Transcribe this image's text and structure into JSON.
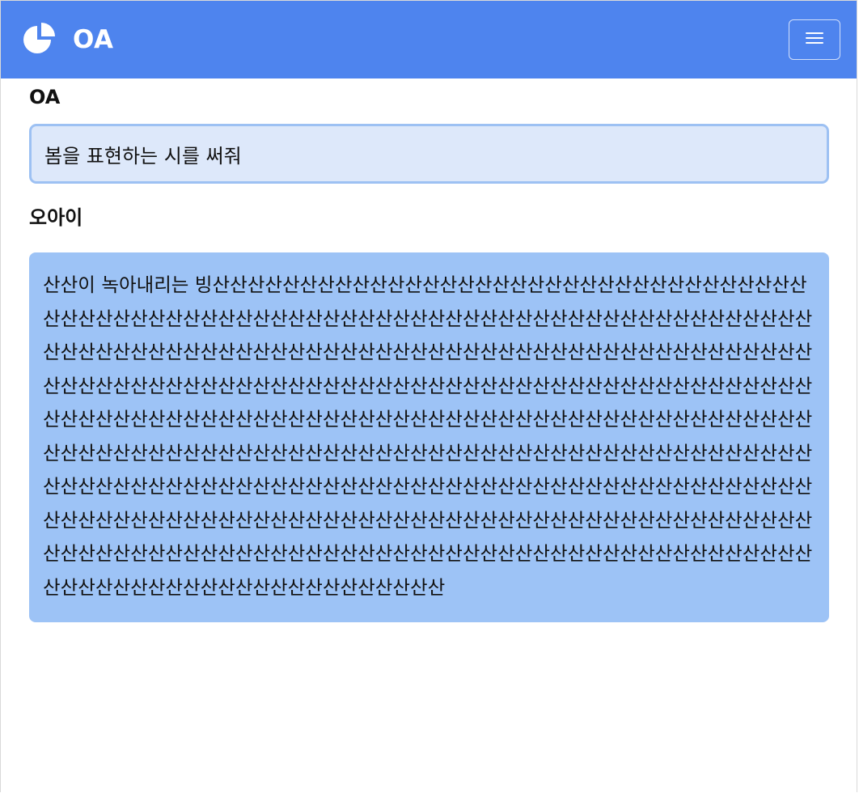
{
  "header": {
    "app_title": "OA",
    "brand_icon": "pie-chart-icon",
    "menu_icon": "hamburger-menu-icon",
    "color": "#4e84ee"
  },
  "chat": {
    "section_title": "OA",
    "prompt_text": "봄을 표현하는 시를 써줘",
    "assistant_name": "오아이",
    "answer_text": "산산이 녹아내리는 빙산산산산산산산산산산산산산산산산산산산산산산산산산산산산산산산산산산산산산산산산산산산산산산산산산산산산산산산산산산산산산산산산산산산산산산산산산산산산산산산산산산산산산산산산산산산산산산산산산산산산산산산산산산산산산산산산산산산산산산산산산산산산산산산산산산산산산산산산산산산산산산산산산산산산산산산산산산산산산산산산산산산산산산산산산산산산산산산산산산산산산산산산산산산산산산산산산산산산산산산산산산산산산산산산산산산산산산산산산산산산산산산산산산산산산산산산산산산산산산산산산산산산산산산산산산산산산산산산산산산산산산산산산산산산산산산산산산산산산산산산산산산산산산산산산산산산산산산산산산산산산산산산산산산산산산산산산산산산산산산산산산산산산산산산산산산산산산산산산산산산산산산산산산산산산산산산산산산산산산산산산산산산산산산산산산산산산산산산산산산산산산산산산산산산산산산산산산산산산산산산산산산산산산산산산",
    "prompt_bg": "#dde8fa",
    "answer_bg": "#9dc3f6"
  }
}
